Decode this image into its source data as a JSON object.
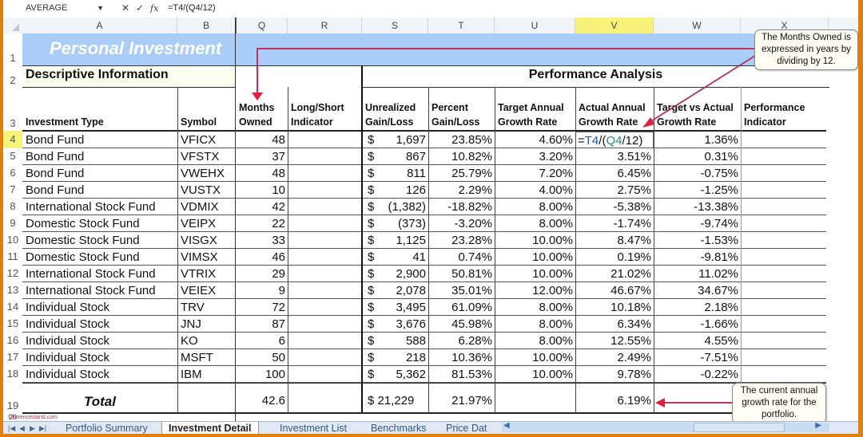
{
  "formula_bar": {
    "name_box": "AVERAGE",
    "cancel_icon": "✕",
    "enter_icon": "✓",
    "fx_label": "fx",
    "formula": "=T4/(Q4/12)"
  },
  "column_headers": [
    "A",
    "B",
    "Q",
    "R",
    "S",
    "T",
    "U",
    "V",
    "W",
    "X"
  ],
  "selected_column": "V",
  "row_numbers": [
    "1",
    "2",
    "3",
    "4",
    "5",
    "6",
    "7",
    "8",
    "9",
    "10",
    "11",
    "12",
    "13",
    "14",
    "15",
    "16",
    "17",
    "18",
    "19",
    "20"
  ],
  "sheet": {
    "title": "Personal Investment",
    "section_left": "Descriptive Information",
    "section_right": "Performance Analysis",
    "headers": {
      "investment_type": "Investment Type",
      "symbol": "Symbol",
      "months_owned_1": "Months",
      "months_owned_2": "Owned",
      "long_short_1": "Long/Short",
      "long_short_2": "Indicator",
      "unrealized_1": "Unrealized",
      "unrealized_2": "Gain/Loss",
      "percent_1": "Percent",
      "percent_2": "Gain/Loss",
      "target_1": "Target Annual",
      "target_2": "Growth Rate",
      "actual_1": "Actual Annual",
      "actual_2": "Growth Rate",
      "tva_1": "Target vs Actual",
      "tva_2": "Growth Rate",
      "perf_1": "Performance",
      "perf_2": "Indicator"
    },
    "rows": [
      {
        "type": "Bond Fund",
        "symbol": "VFICX",
        "months": "48",
        "gain_cur": "$",
        "gain": "1,697",
        "pct": "23.85%",
        "target": "4.60%",
        "actual": "=T4/(Q4/12)",
        "tva": "1.36%"
      },
      {
        "type": "Bond Fund",
        "symbol": "VFSTX",
        "months": "37",
        "gain_cur": "$",
        "gain": "867",
        "pct": "10.82%",
        "target": "3.20%",
        "actual": "3.51%",
        "tva": "0.31%"
      },
      {
        "type": "Bond Fund",
        "symbol": "VWEHX",
        "months": "48",
        "gain_cur": "$",
        "gain": "811",
        "pct": "25.79%",
        "target": "7.20%",
        "actual": "6.45%",
        "tva": "-0.75%"
      },
      {
        "type": "Bond Fund",
        "symbol": "VUSTX",
        "months": "10",
        "gain_cur": "$",
        "gain": "126",
        "pct": "2.29%",
        "target": "4.00%",
        "actual": "2.75%",
        "tva": "-1.25%"
      },
      {
        "type": "International Stock Fund",
        "symbol": "VDMIX",
        "months": "42",
        "gain_cur": "$",
        "gain": "(1,382)",
        "pct": "-18.82%",
        "target": "8.00%",
        "actual": "-5.38%",
        "tva": "-13.38%"
      },
      {
        "type": "Domestic Stock Fund",
        "symbol": "VEIPX",
        "months": "22",
        "gain_cur": "$",
        "gain": "(373)",
        "pct": "-3.20%",
        "target": "8.00%",
        "actual": "-1.74%",
        "tva": "-9.74%"
      },
      {
        "type": "Domestic Stock Fund",
        "symbol": "VISGX",
        "months": "33",
        "gain_cur": "$",
        "gain": "1,125",
        "pct": "23.28%",
        "target": "10.00%",
        "actual": "8.47%",
        "tva": "-1.53%"
      },
      {
        "type": "Domestic Stock Fund",
        "symbol": "VIMSX",
        "months": "46",
        "gain_cur": "$",
        "gain": "41",
        "pct": "0.74%",
        "target": "10.00%",
        "actual": "0.19%",
        "tva": "-9.81%"
      },
      {
        "type": "International Stock Fund",
        "symbol": "VTRIX",
        "months": "29",
        "gain_cur": "$",
        "gain": "2,900",
        "pct": "50.81%",
        "target": "10.00%",
        "actual": "21.02%",
        "tva": "11.02%"
      },
      {
        "type": "International Stock Fund",
        "symbol": "VEIEX",
        "months": "9",
        "gain_cur": "$",
        "gain": "2,078",
        "pct": "35.01%",
        "target": "12.00%",
        "actual": "46.67%",
        "tva": "34.67%"
      },
      {
        "type": "Individual Stock",
        "symbol": "TRV",
        "months": "72",
        "gain_cur": "$",
        "gain": "3,495",
        "pct": "61.09%",
        "target": "8.00%",
        "actual": "10.18%",
        "tva": "2.18%"
      },
      {
        "type": "Individual Stock",
        "symbol": "JNJ",
        "months": "87",
        "gain_cur": "$",
        "gain": "3,676",
        "pct": "45.98%",
        "target": "8.00%",
        "actual": "6.34%",
        "tva": "-1.66%"
      },
      {
        "type": "Individual Stock",
        "symbol": "KO",
        "months": "6",
        "gain_cur": "$",
        "gain": "588",
        "pct": "6.28%",
        "target": "8.00%",
        "actual": "12.55%",
        "tva": "4.55%"
      },
      {
        "type": "Individual Stock",
        "symbol": "MSFT",
        "months": "50",
        "gain_cur": "$",
        "gain": "218",
        "pct": "10.36%",
        "target": "10.00%",
        "actual": "2.49%",
        "tva": "-7.51%"
      },
      {
        "type": "Individual Stock",
        "symbol": "IBM",
        "months": "100",
        "gain_cur": "$",
        "gain": "5,362",
        "pct": "81.53%",
        "target": "10.00%",
        "actual": "9.78%",
        "tva": "-0.22%"
      }
    ],
    "total": {
      "label": "Total",
      "months": "42.6",
      "gain": "$ 21,229",
      "pct": "21.97%",
      "actual": "6.19%"
    },
    "formula_parts": {
      "eq": "=",
      "ref1": "T4",
      "mid": "/(",
      "ref2": "Q4",
      "end": "/12)"
    }
  },
  "callouts": {
    "months_owned": "The Months Owned is expressed in years by dividing by 12.",
    "growth_rate": "The current annual growth rate for the portfolio."
  },
  "watermark": "©florencesland.com",
  "tabs": [
    "Portfolio Summary",
    "Investment Detail",
    "Investment List",
    "Benchmarks",
    "Price Dat"
  ],
  "active_tab": "Investment Detail",
  "colors": {
    "title_band": "#a9cdf7",
    "selected_header": "#f8f27a",
    "callout_arrow": "#d0304a",
    "window_border": "#e07f10"
  }
}
